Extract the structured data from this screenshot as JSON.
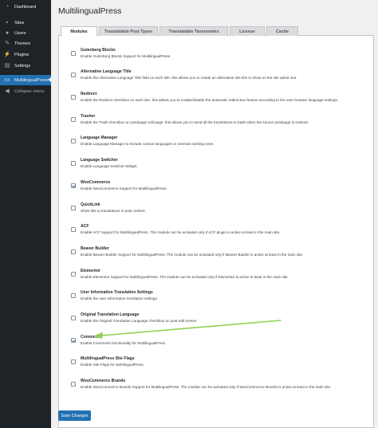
{
  "sidebar": {
    "items": [
      {
        "label": "Dashboard",
        "icon": "dashboard-icon",
        "glyph": "◔"
      },
      {
        "label": "Sites",
        "icon": "sites-icon",
        "glyph": "▪"
      },
      {
        "label": "Users",
        "icon": "users-icon",
        "glyph": "●"
      },
      {
        "label": "Themes",
        "icon": "themes-icon",
        "glyph": "✎"
      },
      {
        "label": "Plugins",
        "icon": "plugins-icon",
        "glyph": "⚡"
      },
      {
        "label": "Settings",
        "icon": "settings-icon",
        "glyph": "▤"
      },
      {
        "label": "MultilingualPress",
        "icon": "multilingualpress-icon",
        "glyph": "▭",
        "current": true
      },
      {
        "label": "Collapse menu",
        "icon": "collapse-icon",
        "glyph": "◀"
      }
    ]
  },
  "page": {
    "title": "MultilingualPress"
  },
  "tabs": [
    {
      "label": "Modules",
      "active": true
    },
    {
      "label": "Translatable Post Types"
    },
    {
      "label": "Translatable Taxonomies"
    },
    {
      "label": "License"
    },
    {
      "label": "Cache"
    }
  ],
  "modules": [
    {
      "title": "Gutenberg Blocks",
      "description": "Enable Gutenberg Blocks Support for MultilingualPress.",
      "checked": false
    },
    {
      "title": "Alternative Language Title",
      "description": "Enable the Alternative Language Title field on each site: this allows you to create an alternative site title to show on the site admin bar.",
      "checked": false
    },
    {
      "title": "Redirect",
      "description": "Enable the Redirect checkbox on each site: this allows you to enable/disable the automatic redirection feature according to the user browser language settings.",
      "checked": false
    },
    {
      "title": "Trasher",
      "description": "Enable the Trash checkbox on post/page edit page: this allows you to send all the translations to trash when the source post/page is trashed.",
      "checked": false
    },
    {
      "title": "Language Manager",
      "description": "Enable Language Manager to include custom languages or override existing ones.",
      "checked": false
    },
    {
      "title": "Language Switcher",
      "description": "Enable Language Switcher Widget.",
      "checked": false
    },
    {
      "title": "WooCommerce",
      "description": "Enable WooCommerce Support for MultilingualPress.",
      "checked": true
    },
    {
      "title": "QuickLink",
      "description": "Show link to translations in post content.",
      "checked": false
    },
    {
      "title": "ACF",
      "description": "Enable ACF Support for MultilingualPress. The module can be activated only if ACF plugin is active at least in the main site.",
      "checked": false
    },
    {
      "title": "Beaver Builder",
      "description": "Enable Beaver Builder Support for MultilingualPress. The module can be activated only if Beaver Builder is active at least in the main site.",
      "checked": false
    },
    {
      "title": "Elementor",
      "description": "Enable Elementor Support for MultilingualPress. The module can be activated only if Elementor is active at least in the main site.",
      "checked": false
    },
    {
      "title": "User Information Translation Settings",
      "description": "Enable the user information translation settings.",
      "checked": false
    },
    {
      "title": "Original Translation Language",
      "description": "Enable the Original Translation Language checkbox on post edit screen.",
      "checked": false
    },
    {
      "title": "Comments",
      "description": "Enable Comments functionality for MultilingualPress.",
      "checked": true
    },
    {
      "title": "MultilingualPress Site Flags",
      "description": "Enable Site Flags for MultilingualPress.",
      "checked": false
    },
    {
      "title": "WooCommerce Brands",
      "description": "Enable WooCommerce Brands Support for MultilingualPress. The module can be activated only if WooCommerce Brands is active at least in the main site.",
      "checked": false
    }
  ],
  "footer": {
    "save_label": "Save Changes"
  },
  "colors": {
    "accent": "#2271b1",
    "sidebar_bg": "#1d2327",
    "annotation_arrow": "#8fd14f"
  }
}
